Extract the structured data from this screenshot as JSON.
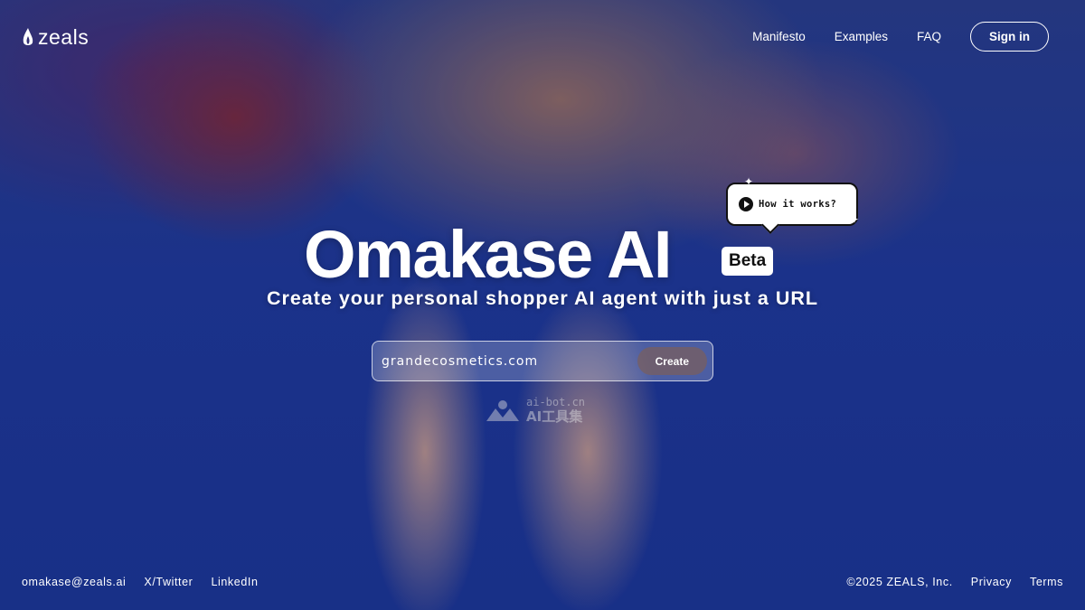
{
  "brand": {
    "name": "zeals"
  },
  "nav": {
    "items": [
      {
        "label": "Manifesto"
      },
      {
        "label": "Examples"
      },
      {
        "label": "FAQ"
      }
    ],
    "signin_label": "Sign in"
  },
  "hero": {
    "title": "Omakase AI",
    "badge": "Beta",
    "how_it_works": "How it works?",
    "subtitle": "Create your personal shopper AI agent with just a URL"
  },
  "form": {
    "url_value": "grandecosmetics.com",
    "create_label": "Create"
  },
  "watermark": {
    "line1": "ai-bot.cn",
    "line2": "AI工具集"
  },
  "footer": {
    "left": [
      {
        "label": "omakase@zeals.ai"
      },
      {
        "label": "X/Twitter"
      },
      {
        "label": "LinkedIn"
      }
    ],
    "copyright": "©2025 ZEALS, Inc.",
    "right": [
      {
        "label": "Privacy"
      },
      {
        "label": "Terms"
      }
    ]
  },
  "colors": {
    "background": "#1e3a8a",
    "text": "#ffffff",
    "create_button": "#785f5f"
  }
}
